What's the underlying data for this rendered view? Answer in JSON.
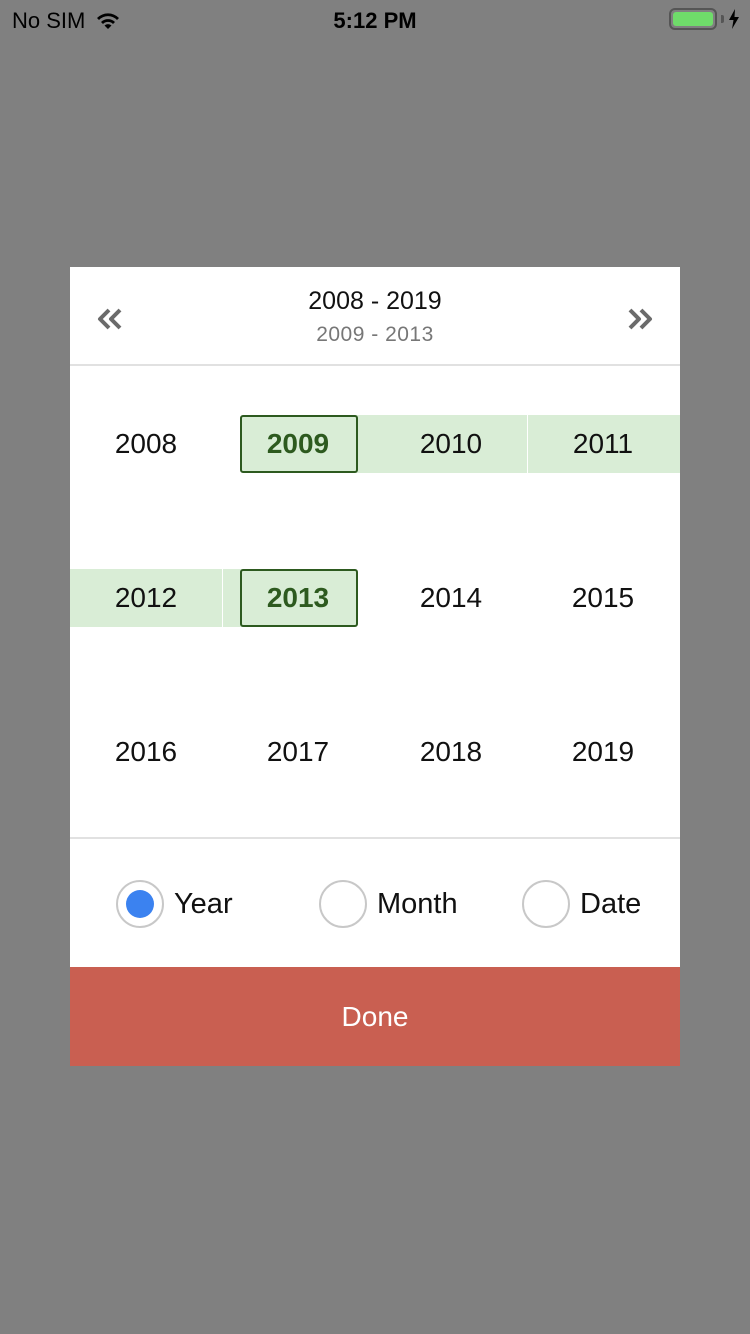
{
  "status_bar": {
    "carrier": "No SIM",
    "time": "5:12 PM"
  },
  "header": {
    "title": "2008 - 2019",
    "selected_range": "2009 - 2013"
  },
  "years": [
    "2008",
    "2009",
    "2010",
    "2011",
    "2012",
    "2013",
    "2014",
    "2015",
    "2016",
    "2017",
    "2018",
    "2019"
  ],
  "selection": {
    "start": "2009",
    "end": "2013"
  },
  "mode": {
    "options": [
      {
        "label": "Year",
        "selected": true
      },
      {
        "label": "Month",
        "selected": false
      },
      {
        "label": "Date",
        "selected": false
      }
    ]
  },
  "done_label": "Done",
  "colors": {
    "overlay": "#808080",
    "range_fill": "#d9edd6",
    "selected_text": "#2d5a1f",
    "radio_active": "#3b82f0",
    "done_button": "#c95f51"
  }
}
